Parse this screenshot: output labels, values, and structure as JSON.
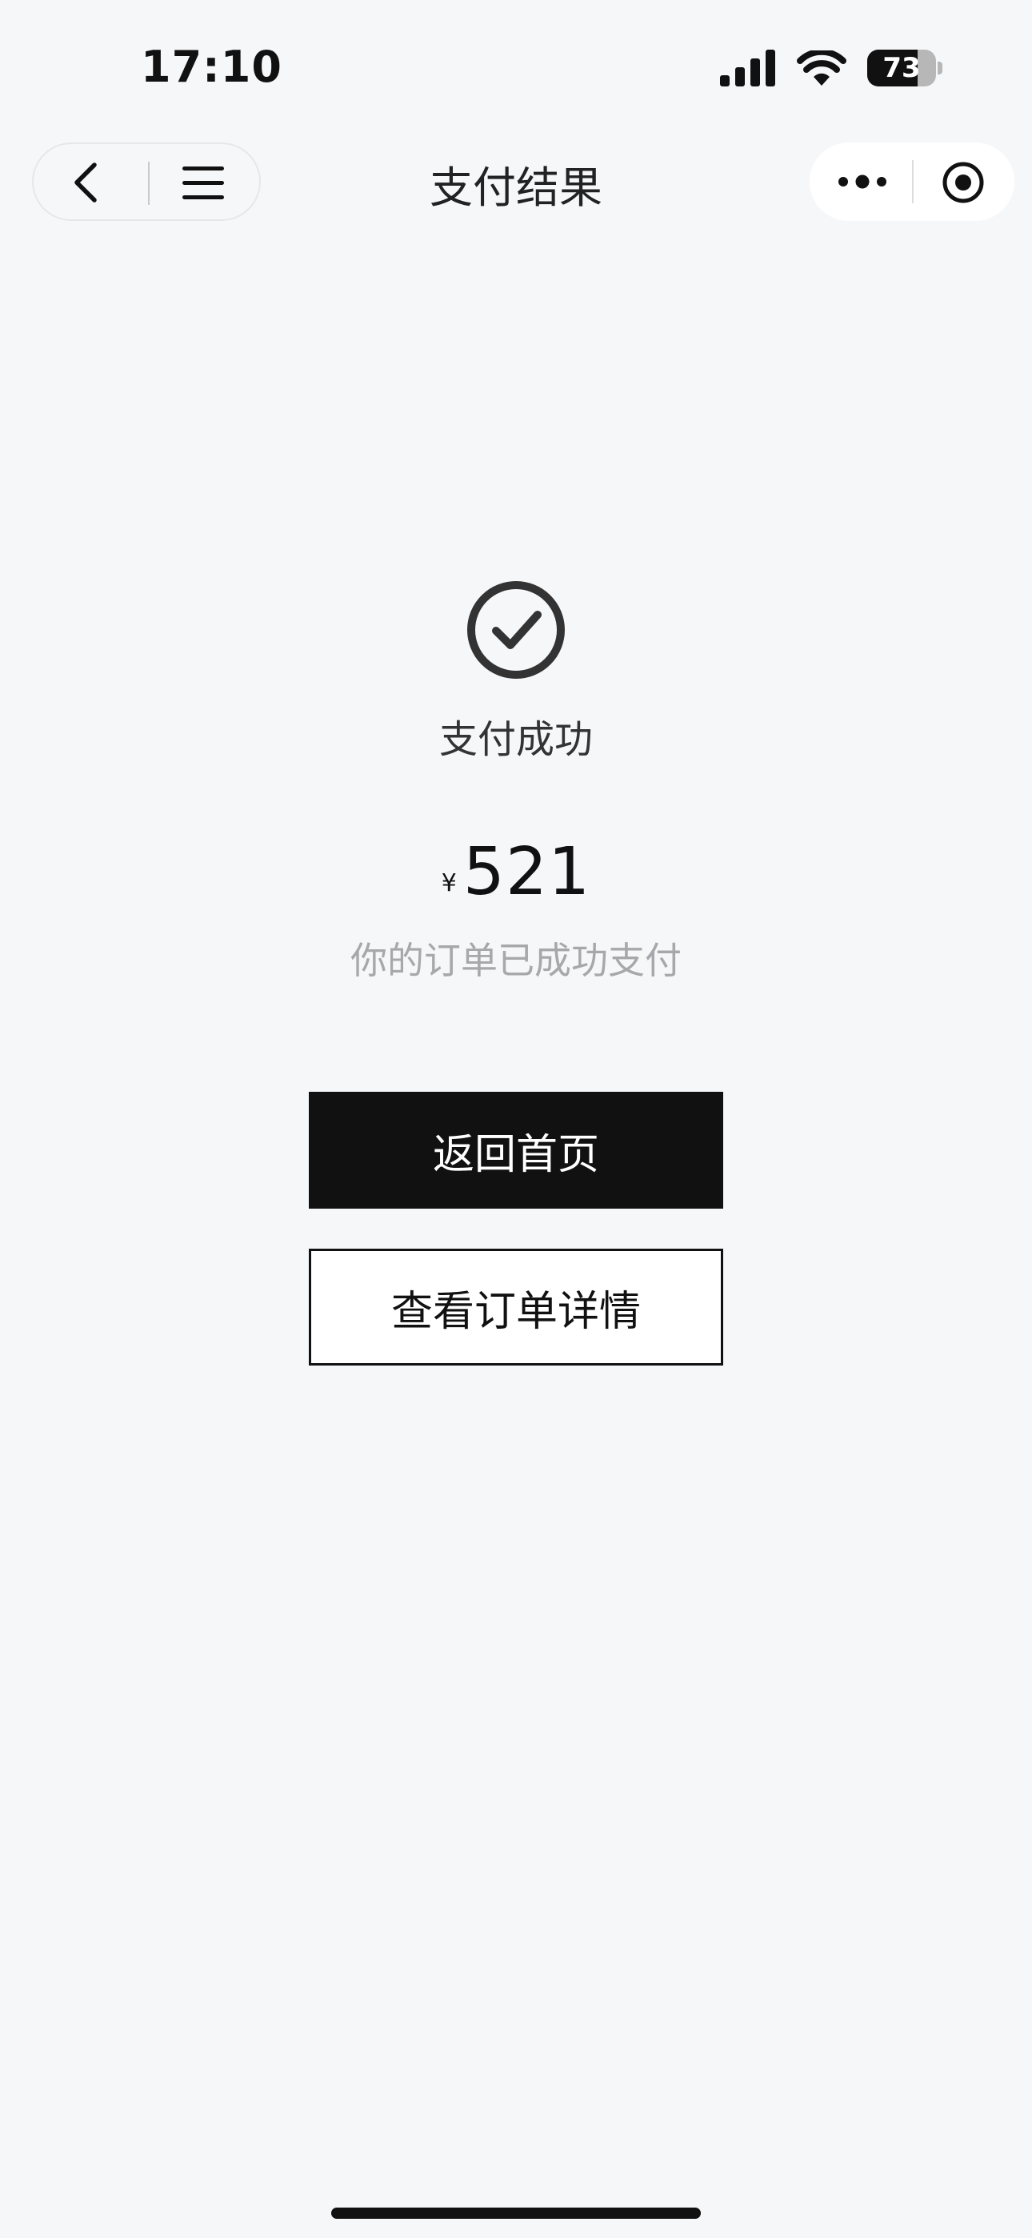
{
  "status_bar": {
    "time": "17:10",
    "battery_level": "73",
    "battery_fraction": 0.73,
    "icons": [
      "signal-icon",
      "wifi-icon",
      "battery-icon"
    ]
  },
  "nav": {
    "title": "支付结果",
    "left_icons": [
      "back-icon",
      "menu-icon"
    ],
    "right_icons": [
      "more-icon",
      "target-icon"
    ]
  },
  "result": {
    "icon": "check-circle-icon",
    "status_text": "支付成功",
    "currency_symbol": "¥",
    "amount": "521",
    "subtitle": "你的订单已成功支付"
  },
  "actions": {
    "primary_label": "返回首页",
    "secondary_label": "查看订单详情"
  },
  "colors": {
    "background": "#f6f7f9",
    "primary_button": "#111111",
    "subtitle": "#a7a8ab"
  }
}
